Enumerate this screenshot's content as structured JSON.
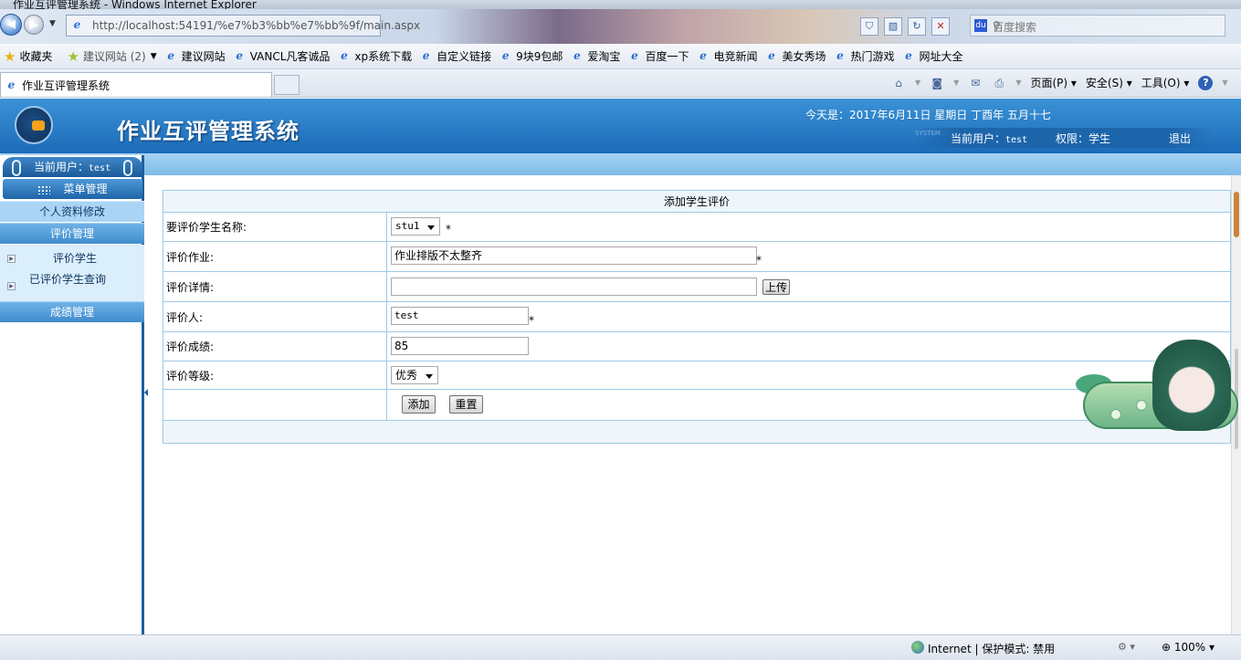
{
  "browser": {
    "window_title": "作业互评管理系统 - Windows Internet Explorer",
    "address_url": "http://localhost:54191/%e7%b3%bb%e7%bb%9f/main.aspx",
    "search_placeholder": "百度搜索",
    "favorites_label": "收藏夹",
    "favorites": [
      {
        "label": "建议网站 (2)",
        "icon": "suggested-sites-icon",
        "dropdown": true
      },
      {
        "label": "建议网站",
        "icon": "ie-icon"
      },
      {
        "label": "VANCL凡客诚品",
        "icon": "ie-icon"
      },
      {
        "label": "xp系统下载",
        "icon": "ie-icon"
      },
      {
        "label": "自定义链接",
        "icon": "ie-icon"
      },
      {
        "label": "9块9包邮",
        "icon": "ie-icon"
      },
      {
        "label": "爱淘宝",
        "icon": "ie-icon"
      },
      {
        "label": "百度一下",
        "icon": "ie-icon"
      },
      {
        "label": "电竞新闻",
        "icon": "ie-icon"
      },
      {
        "label": "美女秀场",
        "icon": "ie-icon"
      },
      {
        "label": "热门游戏",
        "icon": "ie-icon"
      },
      {
        "label": "网址大全",
        "icon": "ie-icon"
      }
    ],
    "tab_title": "作业互评管理系统",
    "commands": {
      "page": "页面(P)",
      "safety": "安全(S)",
      "tools": "工具(O)"
    },
    "status": {
      "zone": "Internet | 保护模式: 禁用",
      "zoom": "100%"
    }
  },
  "app": {
    "title": "作业互评管理系统",
    "date_text": "今天是：2017年6月11日 星期日 丁酉年 五月十七",
    "system_mark": "SYSTEM",
    "current_user_label": "当前用户：",
    "current_user": "test",
    "role_text": "权限：学生",
    "logout": "退出"
  },
  "sidebar": {
    "user_label": "当前用户：",
    "user_name": "test",
    "menu_header": "菜单管理",
    "items": [
      {
        "label": "个人资料修改"
      },
      {
        "label": "评价管理"
      },
      {
        "label": "评价学生"
      },
      {
        "label": "已评价学生查询"
      },
      {
        "label": "成绩管理"
      }
    ]
  },
  "form": {
    "caption": "添加学生评价",
    "student_label": "要评价学生名称:",
    "student_value": "stu1",
    "homework_label": "评价作业:",
    "homework_value": "作业排版不太整齐",
    "detail_label": "评价详情:",
    "detail_value": "",
    "upload_button": "上传",
    "evaluator_label": "评价人:",
    "evaluator_value": "test",
    "score_label": "评价成绩:",
    "score_value": "85",
    "grade_label": "评价等级:",
    "grade_value": "优秀",
    "required_mark": "*",
    "add_button": "添加",
    "reset_button": "重置"
  }
}
